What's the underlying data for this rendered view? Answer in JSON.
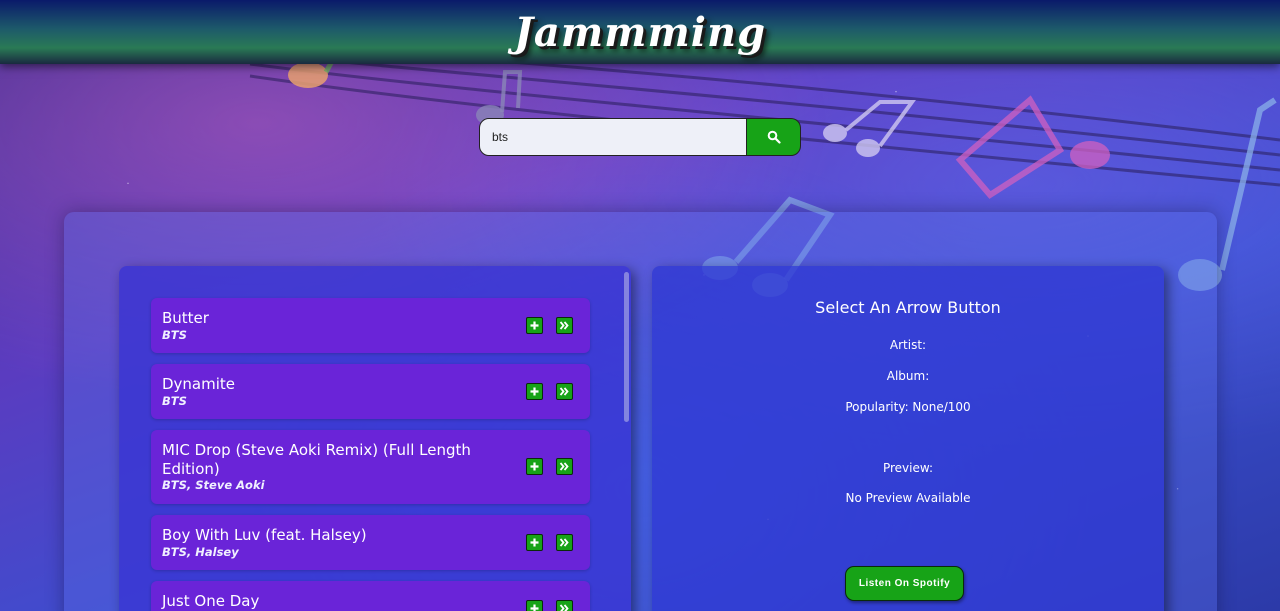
{
  "app": {
    "title": "Jammming"
  },
  "search": {
    "value": "bts",
    "icon": "search-icon"
  },
  "results": [
    {
      "name": "Butter",
      "artist": "BTS"
    },
    {
      "name": "Dynamite",
      "artist": "BTS"
    },
    {
      "name": "MIC Drop (Steve Aoki Remix) (Full Length Edition)",
      "artist": "BTS, Steve Aoki"
    },
    {
      "name": "Boy With Luv (feat. Halsey)",
      "artist": "BTS, Halsey"
    },
    {
      "name": "Just One Day",
      "artist": ""
    }
  ],
  "track_buttons": {
    "add_icon": "plus-icon",
    "select_icon": "double-chevron-right-icon"
  },
  "details": {
    "heading": "Select An Arrow Button",
    "artist_label": "Artist:",
    "album_label": "Album:",
    "popularity_label": "Popularity: None/100",
    "preview_label": "Preview:",
    "preview_value": "No Preview Available",
    "spotify_button": "Listen On Spotify"
  },
  "colors": {
    "accent_green": "#17a317",
    "track_purple": "#6a24d8",
    "header_top": "#0a1a6a"
  }
}
